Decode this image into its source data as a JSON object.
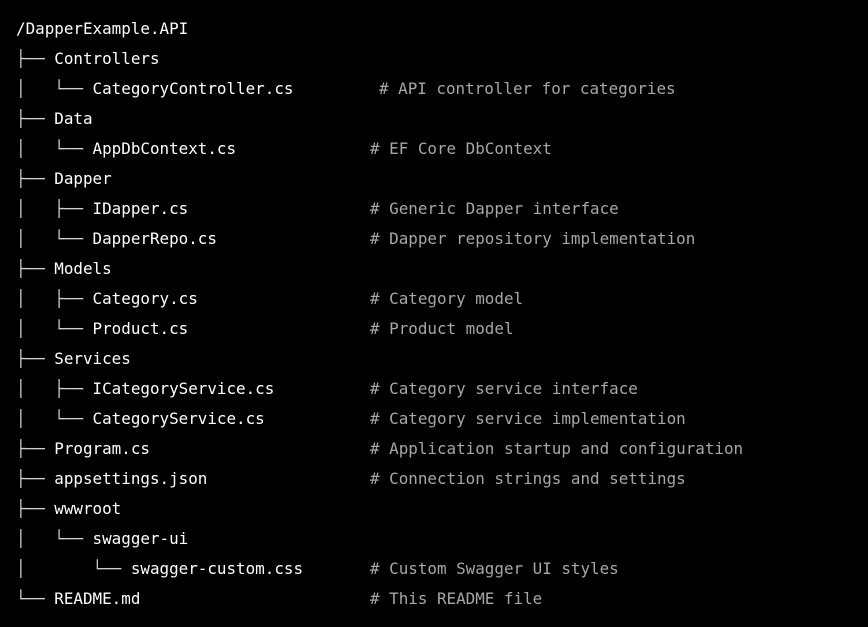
{
  "tree": {
    "root": "/DapperExample.API",
    "lines": [
      {
        "prefix": "├── ",
        "name": "Controllers",
        "comment": ""
      },
      {
        "prefix": "│   └── ",
        "name": "CategoryController.cs",
        "comment": "# API controller for categories"
      },
      {
        "prefix": "├── ",
        "name": "Data",
        "comment": ""
      },
      {
        "prefix": "│   └── ",
        "name": "AppDbContext.cs",
        "comment": "# EF Core DbContext"
      },
      {
        "prefix": "├── ",
        "name": "Dapper",
        "comment": ""
      },
      {
        "prefix": "│   ├── ",
        "name": "IDapper.cs",
        "comment": "# Generic Dapper interface"
      },
      {
        "prefix": "│   └── ",
        "name": "DapperRepo.cs",
        "comment": "# Dapper repository implementation"
      },
      {
        "prefix": "├── ",
        "name": "Models",
        "comment": ""
      },
      {
        "prefix": "│   ├── ",
        "name": "Category.cs",
        "comment": "# Category model"
      },
      {
        "prefix": "│   └── ",
        "name": "Product.cs",
        "comment": "# Product model"
      },
      {
        "prefix": "├── ",
        "name": "Services",
        "comment": ""
      },
      {
        "prefix": "│   ├── ",
        "name": "ICategoryService.cs",
        "comment": "# Category service interface"
      },
      {
        "prefix": "│   └── ",
        "name": "CategoryService.cs",
        "comment": "# Category service implementation"
      },
      {
        "prefix": "├── ",
        "name": "Program.cs",
        "comment": "# Application startup and configuration"
      },
      {
        "prefix": "├── ",
        "name": "appsettings.json",
        "comment": "# Connection strings and settings"
      },
      {
        "prefix": "├── ",
        "name": "wwwroot",
        "comment": ""
      },
      {
        "prefix": "│   └── ",
        "name": "swagger-ui",
        "comment": ""
      },
      {
        "prefix": "│       └── ",
        "name": "swagger-custom.css",
        "comment": "# Custom Swagger UI styles"
      },
      {
        "prefix": "└── ",
        "name": "README.md",
        "comment": "# This README file"
      }
    ]
  }
}
